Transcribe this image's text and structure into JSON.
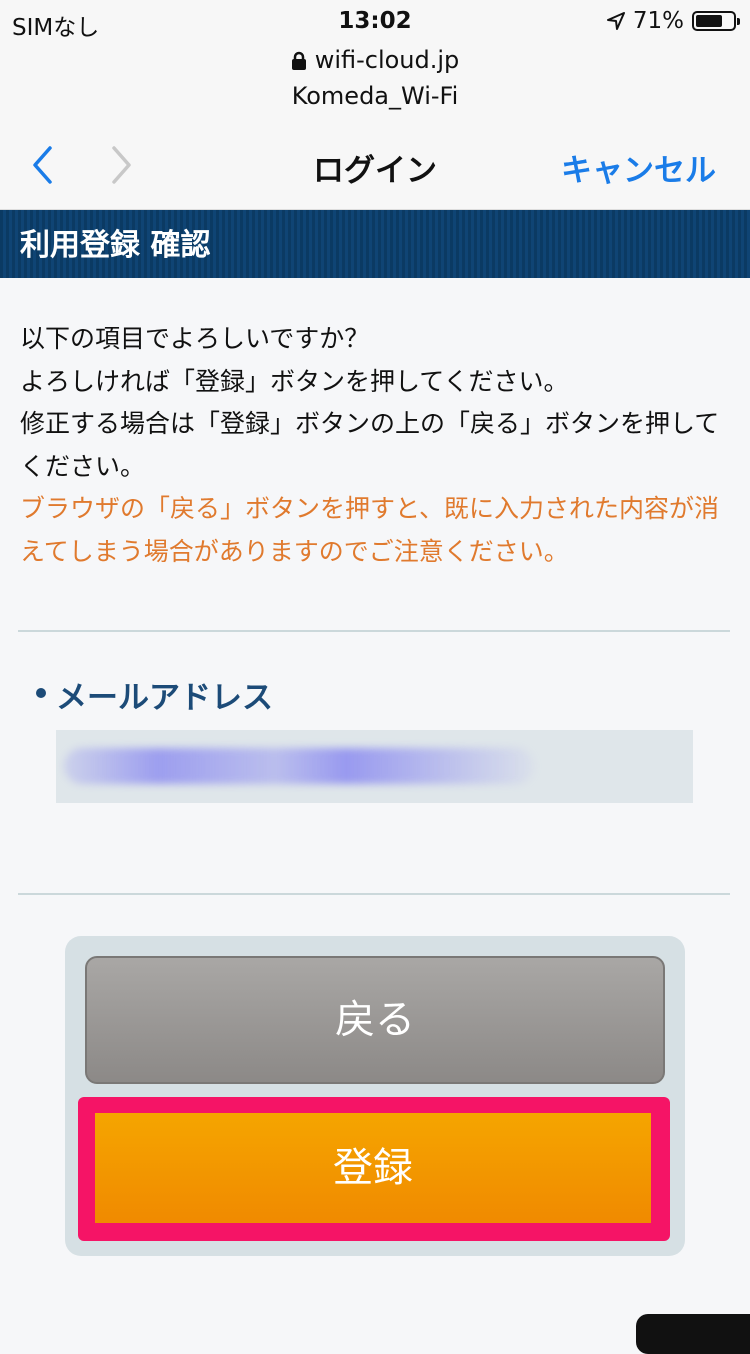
{
  "status_bar": {
    "carrier": "SIMなし",
    "time": "13:02",
    "battery": "71%",
    "battery_level": 0.71
  },
  "browser": {
    "url": "wifi-cloud.jp",
    "ssid": "Komeda_Wi-Fi"
  },
  "nav": {
    "title": "ログイン",
    "cancel": "キャンセル"
  },
  "section": {
    "title": "利用登録 確認"
  },
  "intro": {
    "line1": "以下の項目でよろしいですか？",
    "line2": "よろしければ「登録」ボタンを押してください。",
    "line3": "修正する場合は「登録」ボタンの上の「戻る」ボタンを押してください。",
    "warning": "ブラウザの「戻る」ボタンを押すと、既に入力された内容が消えてしまう場合がありますのでご注意ください。"
  },
  "form": {
    "email_label": "メールアドレス"
  },
  "buttons": {
    "back": "戻る",
    "register": "登録"
  },
  "colors": {
    "header_bg": "#0b3a63",
    "link_blue": "#1a7ce8",
    "warning_orange": "#e07a2e",
    "label_blue": "#1c4b78",
    "register_orange": "#f5a500",
    "highlight_pink": "#f51466",
    "back_gray": "#9a9896"
  }
}
